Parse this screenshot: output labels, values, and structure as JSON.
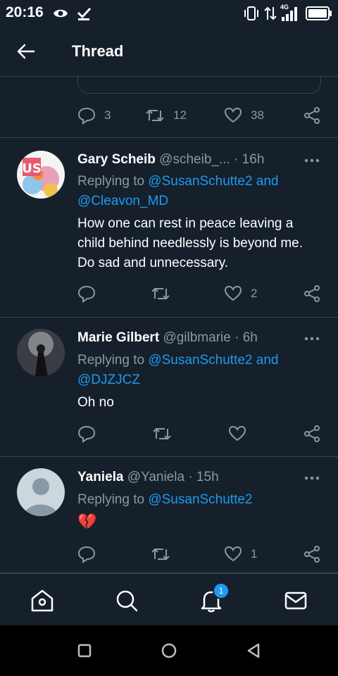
{
  "status_bar": {
    "time": "20:16",
    "network": "4G"
  },
  "header": {
    "title": "Thread"
  },
  "first_tweet": {
    "replies": "3",
    "retweets": "12",
    "likes": "38"
  },
  "tweets": [
    {
      "name": "Gary Scheib",
      "handle": "@scheib_...",
      "time": "· 16h",
      "replying_prefix": "Replying to",
      "replying_line1_link": "@SusanSchutte2",
      "replying_and": "and",
      "replying_line2_link": "@Cleavon_MD",
      "body": "How one can rest in peace leaving a child behind needlessly is beyond me. Do sad and unnecessary.",
      "likes": "2"
    },
    {
      "name": "Marie Gilbert",
      "handle": "@gilbmarie",
      "time": "· 6h",
      "replying_prefix": "Replying to",
      "replying_line1_link": "@SusanSchutte2",
      "replying_and": "and",
      "replying_line2_link": "@DJZJCZ",
      "body": "Oh no"
    },
    {
      "name": "Yaniela",
      "handle": "@Yaniela",
      "time": "· 15h",
      "replying_prefix": "Replying to",
      "replying_line1_link": "@SusanSchutte2",
      "body": "💔",
      "likes": "1"
    }
  ],
  "bottom_nav": {
    "items": [
      "home-icon",
      "search-icon",
      "bell-icon",
      "mail-icon"
    ],
    "notification_badge": "1"
  },
  "system_nav": [
    "recents-square-icon",
    "home-circle-icon",
    "back-triangle-icon"
  ],
  "colors": {
    "background": "#15202b",
    "divider": "#38444d",
    "secondary_text": "#8b98a5",
    "link": "#1d9bf0",
    "heart_emoji": "#e0245e"
  }
}
